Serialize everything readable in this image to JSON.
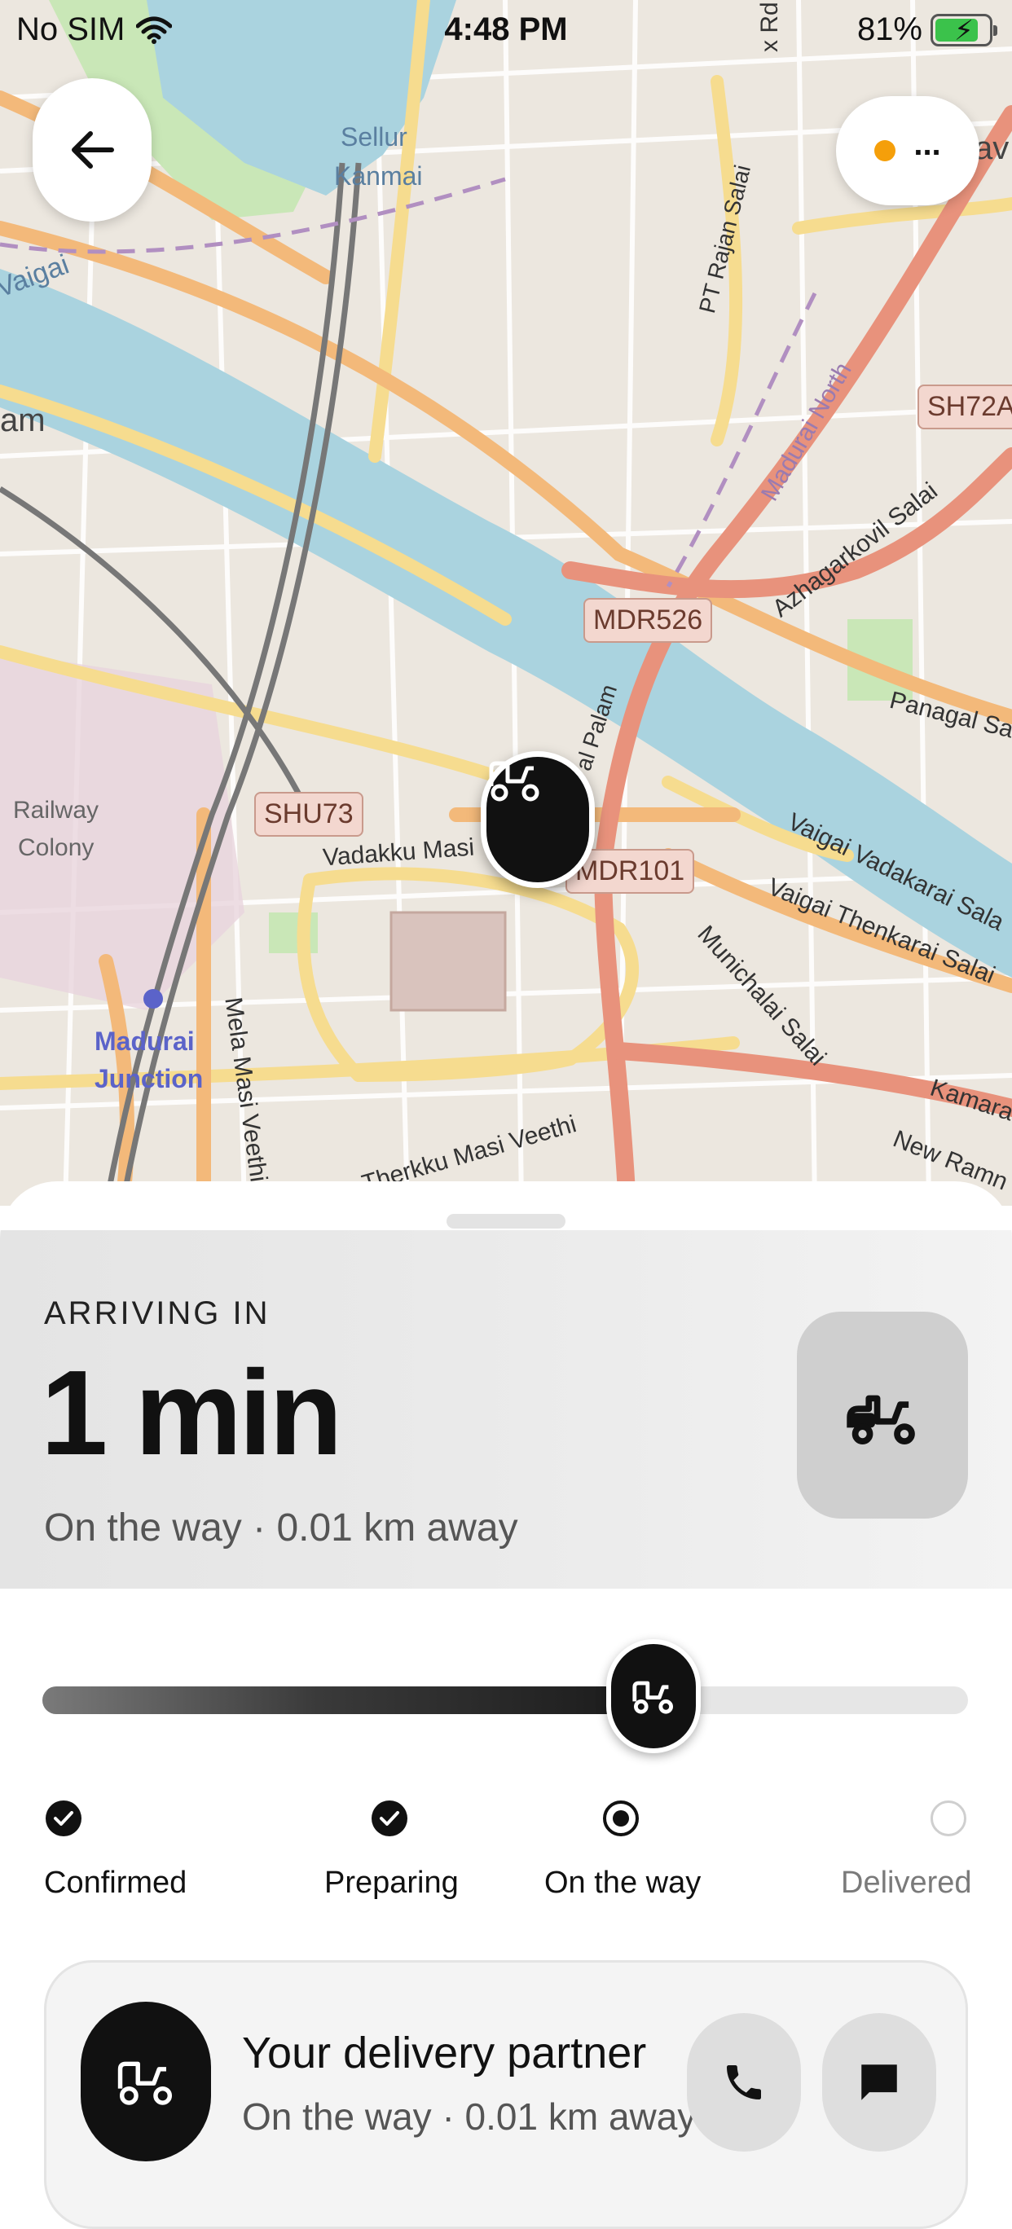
{
  "status_bar": {
    "carrier": "No SIM",
    "time": "4:48 PM",
    "battery_percent": "81%",
    "battery_level": 0.81,
    "icons": [
      "wifi-icon",
      "battery-charging-icon"
    ]
  },
  "map": {
    "labels": {
      "sellur": "Sellur",
      "kanmai": "Kanmai",
      "vaigai": "Vaigai",
      "am": "am",
      "railway": "Railway",
      "colony": "Colony",
      "madurai": "Madurai",
      "junction": "Junction",
      "vadakku": "Vadakku Masi",
      "mela": "Mela Masi Veethi",
      "therkku": "Therkku Masi Veethi",
      "pt_rajan": "PT Rajan Salai",
      "madurai_north": "Madurai North",
      "azhagarkovil": "Azhagarkovil Salai",
      "panagal": "Panagal Sal",
      "vaigai_vadakarai": "Vaigai Vadakarai Sala",
      "vaigai_thenkarai": "Vaigai Thenkarai Salai",
      "munichalai": "Munichalai Salai",
      "kamara": "Kamara",
      "new_ramn": "New Ramn",
      "palam": "al Palam",
      "x_rd": "x Rd",
      "av": "av"
    },
    "road_tags": [
      "MDR526",
      "SHU73",
      "MDR101",
      "SH72A"
    ],
    "vehicle_marker_icon": "scooter-icon"
  },
  "header_buttons": {
    "back_icon": "arrow-left-icon",
    "more_label": "..."
  },
  "eta": {
    "caption": "ARRIVING IN",
    "value": "1 min",
    "subtitle": "On the way · 0.01 km away",
    "tile_icon": "scooter-icon"
  },
  "progress": {
    "fraction": 0.66,
    "knob_icon": "scooter-icon",
    "steps": [
      {
        "label": "Confirmed",
        "state": "done"
      },
      {
        "label": "Preparing",
        "state": "done"
      },
      {
        "label": "On the way",
        "state": "current"
      },
      {
        "label": "Delivered",
        "state": "pending"
      }
    ]
  },
  "partner": {
    "title": "Your delivery partner",
    "subtitle": "On the way · 0.01 km away",
    "avatar_icon": "scooter-icon",
    "call_icon": "phone-icon",
    "message_icon": "message-icon"
  },
  "colors": {
    "accent_dark": "#111111",
    "status_orange": "#f59f0a",
    "river": "#aad3df",
    "major_road": "#e8927c",
    "secondary_road": "#f6c989"
  }
}
